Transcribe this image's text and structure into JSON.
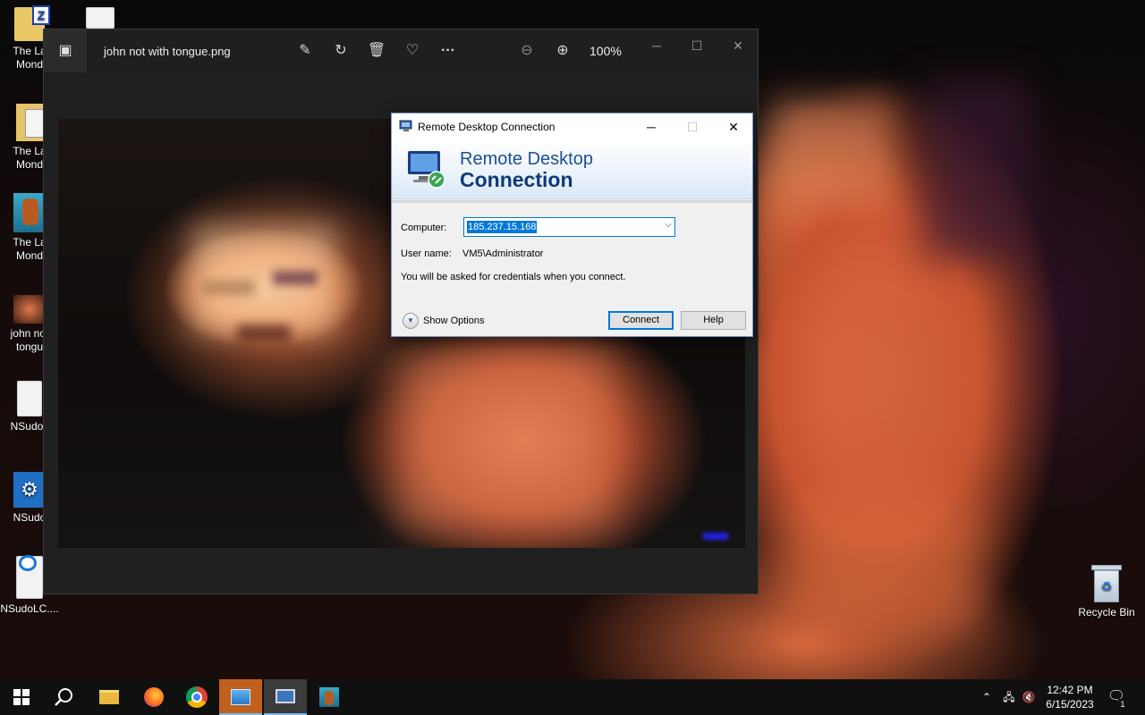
{
  "desktop": {
    "icons": [
      {
        "label": "The La\nMond"
      },
      {
        "label": ""
      },
      {
        "label": "The La\nMond"
      },
      {
        "label": "The La\nMond"
      },
      {
        "label": "john not\ntongu"
      },
      {
        "label": "NSudo.j"
      },
      {
        "label": "NSudo"
      },
      {
        "label": "NSudoLC...."
      },
      {
        "label": "Recycle Bin"
      }
    ]
  },
  "photos": {
    "file_name": "john not with tongue.png",
    "zoom": "100%",
    "toolbar": {
      "edit_icon": "edit-icon",
      "rotate_icon": "rotate-icon",
      "delete_icon": "trash-icon",
      "favorite_icon": "heart-icon",
      "more_label": "···",
      "zoom_out_icon": "zoom-out-icon",
      "zoom_in_icon": "zoom-in-icon"
    }
  },
  "rdc": {
    "title": "Remote Desktop Connection",
    "banner_line1": "Remote Desktop",
    "banner_line2": "Connection",
    "computer_label": "Computer:",
    "computer_value": "185.237.15.168",
    "username_label": "User name:",
    "username_value": "VM5\\Administrator",
    "credentials_note": "You will be asked for credentials when you connect.",
    "show_options_label": "Show Options",
    "connect_label": "Connect",
    "help_label": "Help"
  },
  "taskbar": {
    "clock_time": "12:42 PM",
    "clock_date": "6/15/2023",
    "notification_count": "1",
    "accent_color": "#76b9ed"
  }
}
